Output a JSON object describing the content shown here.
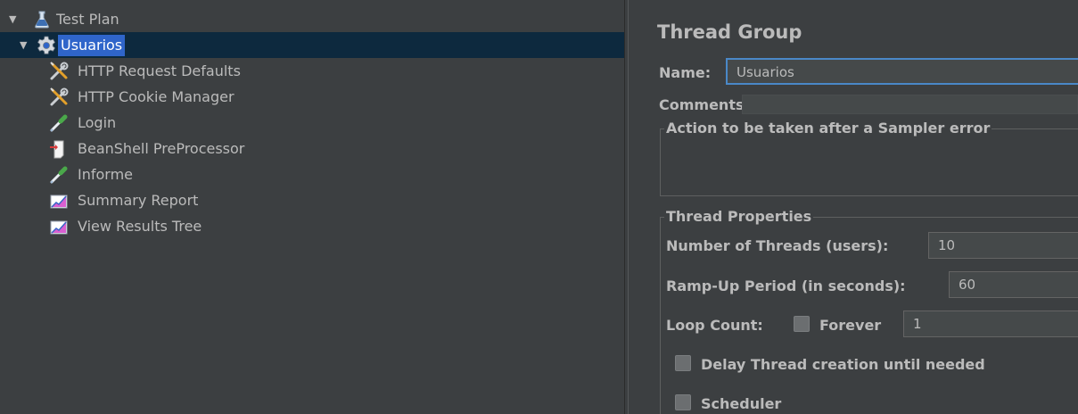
{
  "tree": {
    "items": [
      {
        "label": "Test Plan",
        "icon": "flask-icon",
        "expanded": true
      },
      {
        "label": "Usuarios",
        "icon": "gear-icon",
        "expanded": true,
        "selected": true
      },
      {
        "label": "HTTP Request Defaults",
        "icon": "wrench-screwdriver-icon"
      },
      {
        "label": "HTTP Cookie Manager",
        "icon": "wrench-screwdriver-icon"
      },
      {
        "label": "Login",
        "icon": "pipette-icon"
      },
      {
        "label": "BeanShell PreProcessor",
        "icon": "preprocessor-icon"
      },
      {
        "label": "Informe",
        "icon": "pipette-icon"
      },
      {
        "label": "Summary Report",
        "icon": "graph-icon"
      },
      {
        "label": "View Results Tree",
        "icon": "graph-icon"
      }
    ]
  },
  "panel": {
    "title": "Thread Group",
    "name_label": "Name:",
    "name_value": "Usuarios",
    "comments_label": "Comments:",
    "sampler_error_group": "Action to be taken after a Sampler error",
    "thread_props_group": "Thread Properties",
    "threads_label": "Number of Threads (users):",
    "threads_value": "10",
    "rampup_label": "Ramp-Up Period (in seconds):",
    "rampup_value": "60",
    "loop_label": "Loop Count:",
    "forever_label": "Forever",
    "forever_checked": false,
    "loop_value": "1",
    "delay_label": "Delay Thread creation until needed",
    "delay_checked": false,
    "scheduler_label": "Scheduler",
    "scheduler_checked": false
  },
  "colors": {
    "background": "#3c3f41",
    "selection": "#2f65ca",
    "text": "#bbbbbb",
    "input_bg": "#45494a",
    "focus_border": "#4a88c7"
  }
}
